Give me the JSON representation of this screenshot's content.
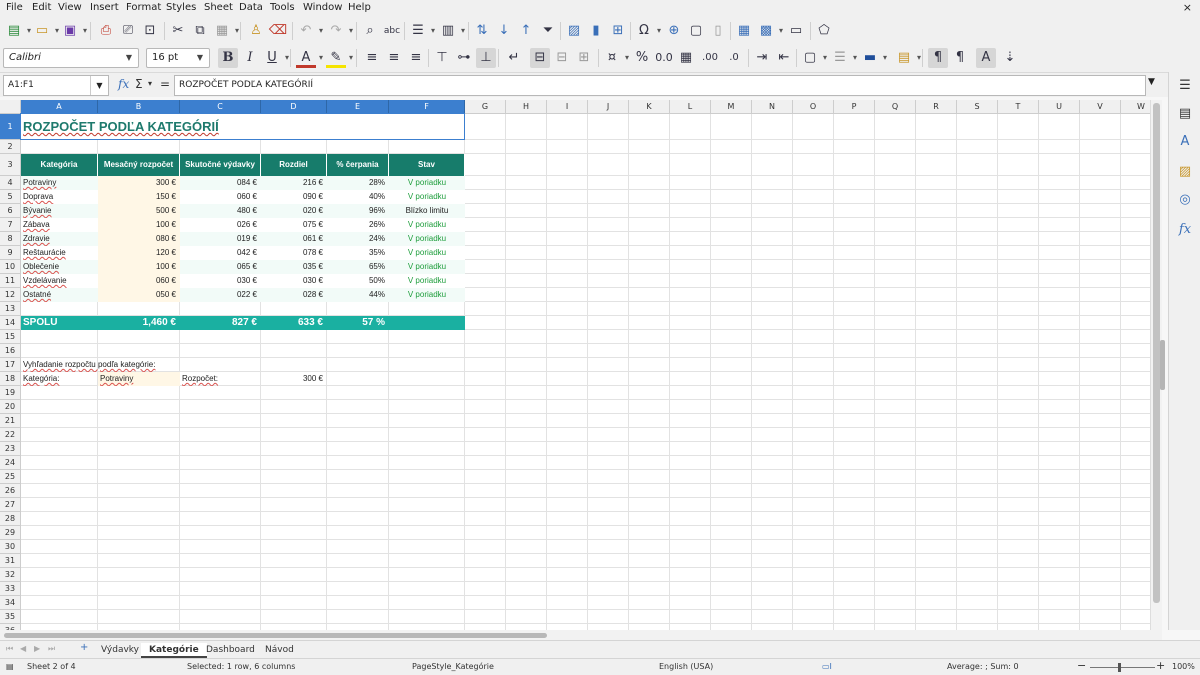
{
  "menu": [
    "File",
    "Edit",
    "View",
    "Insert",
    "Format",
    "Styles",
    "Sheet",
    "Data",
    "Tools",
    "Window",
    "Help"
  ],
  "window_close": "×",
  "toolbar": {
    "font_name": "Calibri",
    "font_size": "16 pt",
    "bold": "B",
    "italic": "I",
    "underline": "U"
  },
  "formula_bar": {
    "name_box": "A1:F1",
    "fx_icon": "fx",
    "sum_icon": "Σ",
    "equals_icon": "=",
    "content": "ROZPOČET PODĽA KATEGÓRIÍ"
  },
  "columns": [
    "A",
    "B",
    "C",
    "D",
    "E",
    "F",
    "G",
    "H",
    "I",
    "J",
    "K",
    "L",
    "M",
    "N",
    "O",
    "P",
    "Q",
    "R",
    "S",
    "T",
    "U",
    "V",
    "W"
  ],
  "rows": [
    "1",
    "2",
    "3",
    "4",
    "5",
    "6",
    "7",
    "8",
    "9",
    "10",
    "11",
    "12",
    "13",
    "14",
    "15",
    "16",
    "17",
    "18",
    "19",
    "20",
    "21",
    "22",
    "23",
    "24",
    "25",
    "26",
    "27",
    "28",
    "29",
    "30",
    "31",
    "32",
    "33",
    "34",
    "35",
    "36"
  ],
  "sheet": {
    "title": "ROZPOČET PODĽA KATEGÓRIÍ",
    "headers": [
      "Kategória",
      "Mesačný rozpočet",
      "Skutočné výdavky",
      "Rozdiel",
      "% čerpania",
      "Stav"
    ],
    "data": [
      [
        "Potraviny",
        "300 €",
        "084 €",
        "216 €",
        "28%",
        "V poriadku"
      ],
      [
        "Doprava",
        "150 €",
        "060 €",
        "090 €",
        "40%",
        "V poriadku"
      ],
      [
        "Bývanie",
        "500 €",
        "480 €",
        "020 €",
        "96%",
        "Blízko limitu"
      ],
      [
        "Zábava",
        "100 €",
        "026 €",
        "075 €",
        "26%",
        "V poriadku"
      ],
      [
        "Zdravie",
        "080 €",
        "019 €",
        "061 €",
        "24%",
        "V poriadku"
      ],
      [
        "Reštaurácie",
        "120 €",
        "042 €",
        "078 €",
        "35%",
        "V poriadku"
      ],
      [
        "Oblečenie",
        "100 €",
        "065 €",
        "035 €",
        "65%",
        "V poriadku"
      ],
      [
        "Vzdelávanie",
        "060 €",
        "030 €",
        "030 €",
        "50%",
        "V poriadku"
      ],
      [
        "Ostatné",
        "050 €",
        "022 €",
        "028 €",
        "44%",
        "V poriadku"
      ]
    ],
    "total": [
      "SPOLU",
      "1,460 €",
      "827 €",
      "633 €",
      "57 %",
      ""
    ],
    "lookup_title": "Vyhľadanie rozpočtu podľa kategórie:",
    "lookup_label": "Kategória:",
    "lookup_value": "Potraviny",
    "budget_label": "Rozpočet:",
    "budget_value": "300 €"
  },
  "tabs": [
    "Výdavky",
    "Kategórie",
    "Dashboard",
    "Návod"
  ],
  "active_tab": "Kategórie",
  "status": {
    "sheet": "Sheet 2 of 4",
    "selection": "Selected: 1 row, 6 columns",
    "page_style": "PageStyle_Kategórie",
    "language": "English (USA)",
    "sum": "Average: ; Sum: 0",
    "zoom": "100%"
  },
  "colors": {
    "header_teal": "#177c6b",
    "total_teal": "#1ab0a1",
    "ok_green": "#1f9e3d",
    "selection_blue": "#3c7fcf"
  }
}
